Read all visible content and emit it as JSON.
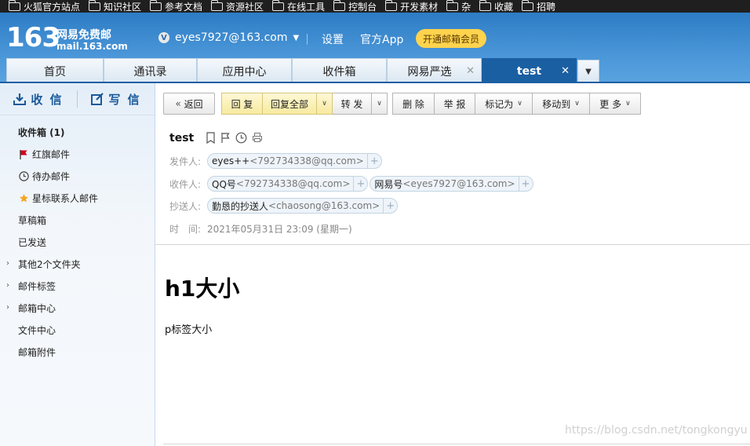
{
  "bookmarks": [
    "火狐官方站点",
    "知识社区",
    "参考文档",
    "资源社区",
    "在线工具",
    "控制台",
    "开发素材",
    "杂",
    "收藏",
    "招聘"
  ],
  "header": {
    "logo_number": "163",
    "logo_title": "网易免费邮",
    "logo_domain": "mail.163.com",
    "user_badge": "V",
    "user_email": "eyes7927@163.com",
    "settings": "设置",
    "official_app": "官方App",
    "vip_button": "开通邮箱会员"
  },
  "tabs": [
    "首页",
    "通讯录",
    "应用中心",
    "收件箱",
    "网易严选",
    "test"
  ],
  "sidebar": {
    "receive": "收 信",
    "write": "写 信",
    "items": [
      "收件箱 (1)",
      "红旗邮件",
      "待办邮件",
      "星标联系人邮件",
      "草稿箱",
      "已发送",
      "其他2个文件夹",
      "邮件标签",
      "邮箱中心",
      "文件中心",
      "邮箱附件"
    ]
  },
  "toolbar": {
    "back": "返回",
    "reply": "回 复",
    "reply_all": "回复全部",
    "forward": "转 发",
    "delete": "删 除",
    "report": "举 报",
    "mark_as": "标记为",
    "move_to": "移动到",
    "more": "更 多"
  },
  "mail": {
    "subject": "test",
    "from_label": "发件人:",
    "from_name": "eyes++",
    "from_addr": "<792734338@qq.com>",
    "to_label": "收件人:",
    "to": [
      {
        "name": "QQ号",
        "addr": "<792734338@qq.com>"
      },
      {
        "name": "网易号",
        "addr": "<eyes7927@163.com>"
      }
    ],
    "cc_label": "抄送人:",
    "cc_name": "勤恳的抄送人",
    "cc_addr": "<chaosong@163.com>",
    "time_label": "时　间:",
    "time_value": "2021年05月31日 23:09 (星期一)"
  },
  "body": {
    "heading": "h1大小",
    "paragraph": "p标签大小"
  },
  "watermark": "https://blog.csdn.net/tongkongyu",
  "colors": {
    "brand_blue": "#1b5fa3",
    "vip_yellow": "#ffd34e",
    "flag_red": "#d0021b",
    "star_yellow": "#f5a623"
  }
}
